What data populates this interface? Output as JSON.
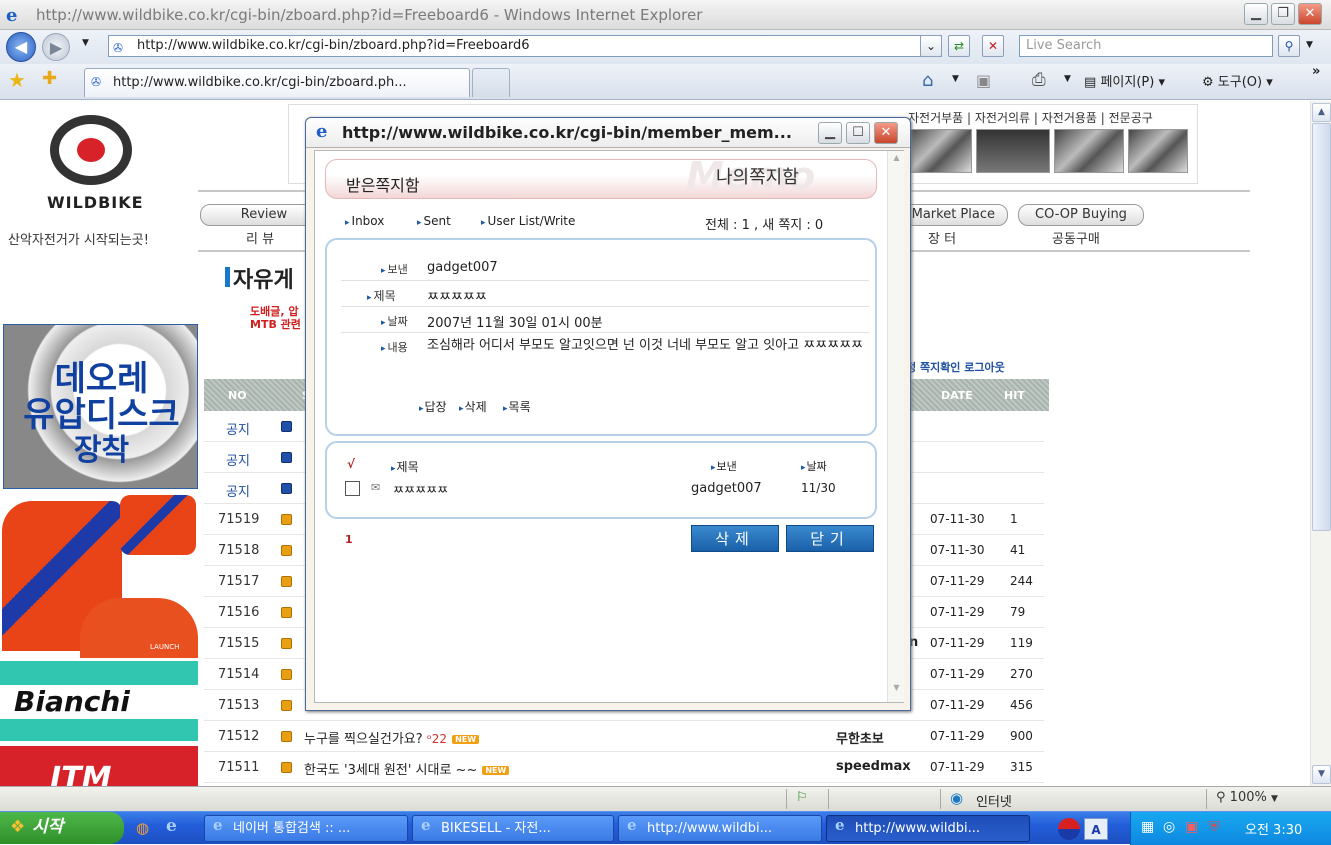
{
  "window": {
    "title": "http://www.wildbike.co.kr/cgi-bin/zboard.php?id=Freeboard6 - Windows Internet Explorer"
  },
  "address_bar": {
    "url": "http://www.wildbike.co.kr/cgi-bin/zboard.php?id=Freeboard6",
    "search_placeholder": "Live Search"
  },
  "tab": {
    "title": "http://www.wildbike.co.kr/cgi-bin/zboard.ph..."
  },
  "toolbar": {
    "page_label": "페이지(P)",
    "tools_label": "도구(O)"
  },
  "site": {
    "logo": "WILDBIKE",
    "slogan": "산악자전거가 시작되는곳!",
    "top_categories": "자전거부품 | 자전거의류 | 자전거용품 | 전문공구",
    "menu": [
      {
        "en": "Review",
        "ko": "리 뷰"
      },
      {
        "en": "Market Place",
        "ko": "장 터"
      },
      {
        "en": "CO-OP Buying",
        "ko": "공동구매"
      }
    ],
    "board_title": "자유게",
    "notice_line1": "도배글, 압",
    "notice_line2": "MTB 관련",
    "login_links": "정  쪽지확인  로그아웃"
  },
  "ads": {
    "deore_line1": "데오레",
    "deore_line2": "유압디스크",
    "deore_line3": "장착",
    "jersey_tag": "LAUNCH",
    "bianchi": "Bianchi",
    "itm": "ITM"
  },
  "board": {
    "headers": {
      "no": "NO",
      "subject": "S",
      "date": "DATE",
      "hit": "HIT"
    },
    "rows": [
      {
        "no": "공지",
        "subject": "",
        "writer": "",
        "date": "",
        "hit": "",
        "notice": true
      },
      {
        "no": "공지",
        "subject": "",
        "writer": "",
        "date": "",
        "hit": "",
        "notice": true
      },
      {
        "no": "공지",
        "subject": ":",
        "writer": "",
        "date": "",
        "hit": "",
        "notice": true
      },
      {
        "no": "71519",
        "subject": "[",
        "writer": "",
        "date": "07-11-30",
        "hit": "1"
      },
      {
        "no": "71518",
        "subject": "(",
        "writer": "",
        "date": "07-11-30",
        "hit": "41"
      },
      {
        "no": "71517",
        "subject": "",
        "writer": "",
        "date": "07-11-29",
        "hit": "244"
      },
      {
        "no": "71516",
        "subject": "",
        "writer": "",
        "date": "07-11-29",
        "hit": "79"
      },
      {
        "no": "71515",
        "subject": "",
        "writer": "n",
        "date": "07-11-29",
        "hit": "119"
      },
      {
        "no": "71514",
        "subject": "",
        "writer": "",
        "date": "07-11-29",
        "hit": "270"
      },
      {
        "no": "71513",
        "subject": "",
        "writer": "",
        "date": "07-11-29",
        "hit": "456"
      },
      {
        "no": "71512",
        "subject": "누구를 찍으실건가요?",
        "comments": "22",
        "writer": "무한초보",
        "date": "07-11-29",
        "hit": "900",
        "new": "NEW"
      },
      {
        "no": "71511",
        "subject": "한국도 '3세대 원전' 시대로 ~~",
        "writer": "speedmax",
        "date": "07-11-29",
        "hit": "315",
        "new": "NEW"
      }
    ]
  },
  "popup": {
    "title": "http://www.wildbike.co.kr/cgi-bin/member_mem...",
    "header_left": "받은쪽지함",
    "header_right": "나의쪽지함",
    "watermark": "Memo",
    "links": [
      "Inbox",
      "Sent",
      "User List/Write"
    ],
    "count": "전체 : 1 , 새 쪽지 : 0",
    "labels": {
      "sender": "보낸",
      "subject": "제목",
      "date": "날짜",
      "content": "내용"
    },
    "message": {
      "sender": "gadget007",
      "subject": "ㅉㅉㅉㅉㅉ",
      "date": "2007년 11월 30일 01시 00분",
      "content": "조심해라 어디서 부모도 알고잇으면 넌 이것 너네 부모도 알고 잇아고 ㅉㅉㅉㅉㅉ"
    },
    "actions": [
      "답장",
      "삭제",
      "목록"
    ],
    "list_headers": {
      "check": "√",
      "subject": "제목",
      "sender": "보낸",
      "date": "날짜"
    },
    "list": [
      {
        "subject": "ㅉㅉㅉㅉㅉ",
        "sender": "gadget007",
        "date": "11/30"
      }
    ],
    "page": "1",
    "delete_label": "삭제",
    "close_label": "닫기"
  },
  "status": {
    "zone": "인터넷",
    "zoom": "100%"
  },
  "taskbar": {
    "start": "시작",
    "items": [
      "네이버 통합검색 :: ...",
      "BIKESELL - 자전...",
      "http://www.wildbi...",
      "http://www.wildbi..."
    ],
    "ime": "A",
    "clock": "오전 3:30"
  }
}
